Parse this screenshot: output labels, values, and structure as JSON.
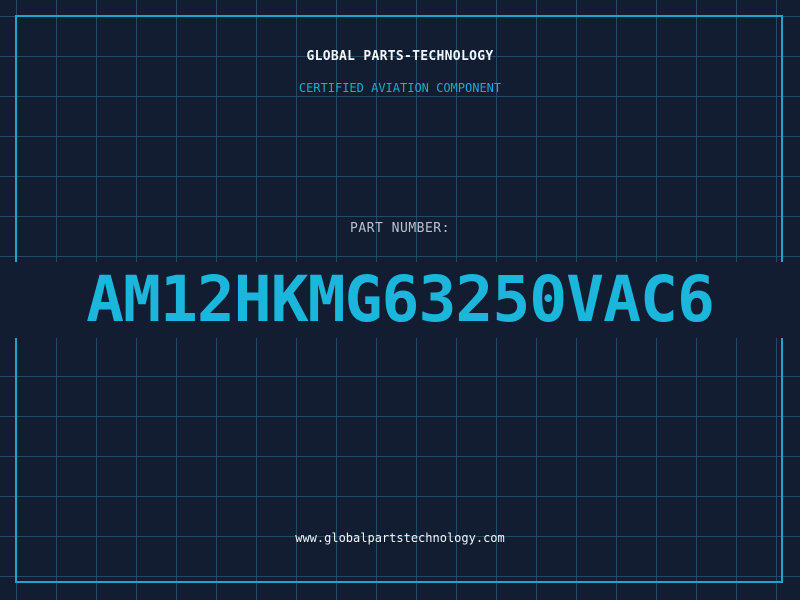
{
  "company": {
    "name": "GLOBAL PARTS-TECHNOLOGY",
    "tagline": "CERTIFIED AVIATION COMPONENT"
  },
  "part": {
    "label": "PART NUMBER:",
    "number": "AM12HKMG63250VAC6"
  },
  "footer": {
    "website": "www.globalpartstechnology.com"
  },
  "colors": {
    "background": "#121d31",
    "grid": "#214b66",
    "frame": "#1ea6c8",
    "accent": "#1bb6dc",
    "text": "#f2f6fa",
    "muted_text": "#b9c2cf"
  }
}
